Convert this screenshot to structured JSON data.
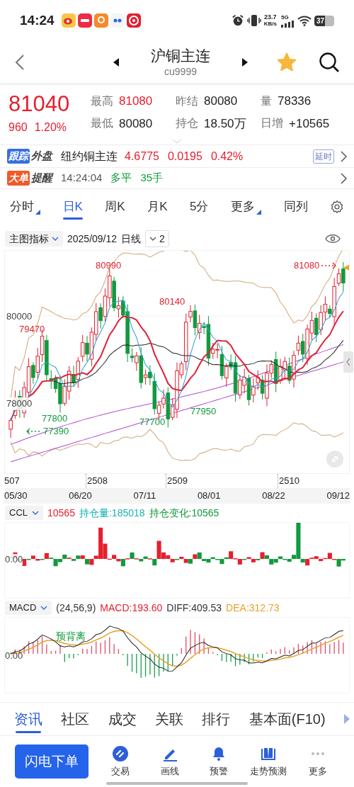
{
  "status_bar": {
    "time": "14:24",
    "network_speed": "23.7",
    "network_speed_unit": "KB/s",
    "network_type": "5G",
    "battery": "37"
  },
  "header": {
    "title": "沪铜主连",
    "code": "cu9999",
    "favorite": true
  },
  "quote": {
    "price": "81040",
    "change": "960",
    "change_pct": "1.20%",
    "stats": [
      {
        "label": "最高",
        "value": "81080",
        "kind": "up"
      },
      {
        "label": "昨结",
        "value": "80080",
        "kind": "flat"
      },
      {
        "label": "量",
        "value": "78336",
        "kind": "flat"
      },
      {
        "label": "最低",
        "value": "80080",
        "kind": "flat"
      },
      {
        "label": "持仓",
        "value": "18.50万",
        "kind": "flat"
      },
      {
        "label": "日增",
        "value": "+10565",
        "kind": "flat"
      }
    ]
  },
  "foreign": {
    "tag": "跟踪",
    "tag_suffix": "外盘",
    "name": "纽约铜主连",
    "values": [
      "4.6775",
      "0.0195",
      "0.42%"
    ],
    "badge": "延时"
  },
  "big_order": {
    "tag": "大单",
    "tag_suffix": "提醒",
    "time": "14:24:04",
    "action": "多平",
    "volume": "35手"
  },
  "period_tabs": [
    {
      "label": "分时",
      "selected": false,
      "dropdown": true
    },
    {
      "label": "日K",
      "selected": true,
      "dropdown": false
    },
    {
      "label": "周K",
      "selected": false,
      "dropdown": false
    },
    {
      "label": "月K",
      "selected": false,
      "dropdown": false
    },
    {
      "label": "5分",
      "selected": false,
      "dropdown": false
    },
    {
      "label": "更多",
      "selected": false,
      "dropdown": true
    },
    {
      "label": "同列",
      "selected": false,
      "dropdown": false
    }
  ],
  "chart_toolbar": {
    "indicator": "主图指标",
    "date": "2025/09/12",
    "period": "日线",
    "count": "2"
  },
  "main_chart": {
    "y_labels": [
      "80000",
      "78000"
    ],
    "price_labels": [
      {
        "text": "80990",
        "kind": "high"
      },
      {
        "text": "80140",
        "kind": "high"
      },
      {
        "text": "81080",
        "kind": "latest_high"
      },
      {
        "text": "79470",
        "kind": "high"
      },
      {
        "text": "77800",
        "kind": "low"
      },
      {
        "text": "77700",
        "kind": "low"
      },
      {
        "text": "77950",
        "kind": "low"
      },
      {
        "text": "77390",
        "kind": "lowest"
      }
    ],
    "month_labels": [
      "507",
      "2508",
      "2509",
      "2510"
    ],
    "dates": [
      "05/30",
      "06/20",
      "07/11",
      "08/01",
      "08/22",
      "09/12"
    ]
  },
  "ccl": {
    "indicator": "CCL",
    "value": "10565",
    "open_interest": "持仓量:185018",
    "change": "持仓变化:10565",
    "zero": "0.00"
  },
  "macd": {
    "indicator": "MACD",
    "params": "(24,56,9)",
    "macd": "MACD:193.60",
    "diff": "DIFF:409.53",
    "dea": "DEA:312.73",
    "zero": "0.00",
    "annotation": "预背离"
  },
  "bottom_tabs": [
    {
      "label": "资讯",
      "selected": true
    },
    {
      "label": "社区",
      "selected": false
    },
    {
      "label": "成交",
      "selected": false
    },
    {
      "label": "关联",
      "selected": false
    },
    {
      "label": "排行",
      "selected": false
    },
    {
      "label": "基本面(F10)",
      "selected": false
    }
  ],
  "actions": {
    "primary": "闪电下单",
    "items": [
      {
        "label": "交易",
        "kind": "trade"
      },
      {
        "label": "画线",
        "kind": "draw"
      },
      {
        "label": "预警",
        "kind": "alert"
      },
      {
        "label": "走势预测",
        "kind": "forecast"
      },
      {
        "label": "更多",
        "kind": "more"
      }
    ]
  }
}
